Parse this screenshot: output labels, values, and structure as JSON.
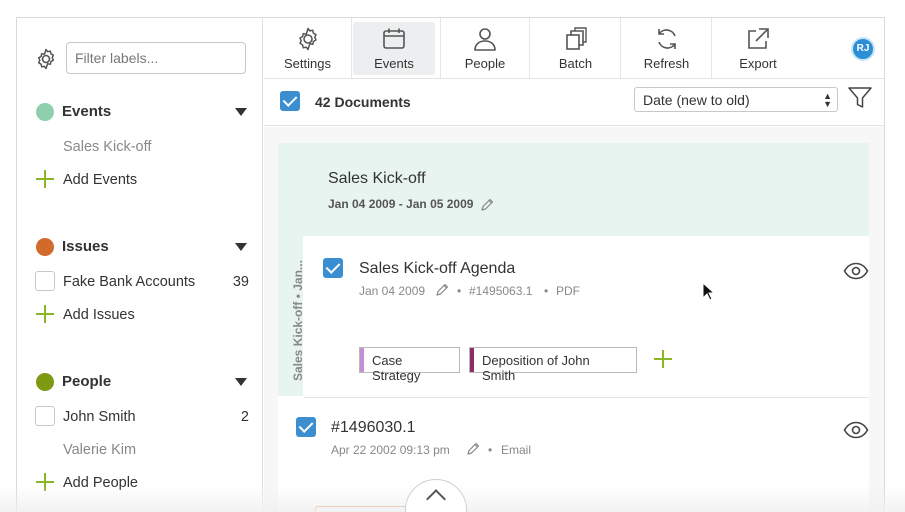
{
  "sidebar": {
    "filter_placeholder": "Filter labels...",
    "groups": [
      {
        "title": "Events",
        "dot_color": "#8ecfad",
        "items": [
          {
            "label": "Sales Kick-off"
          }
        ],
        "add_label": "Add Events"
      },
      {
        "title": "Issues",
        "dot_color": "#d26a2c",
        "items": [
          {
            "label": "Fake Bank Accounts",
            "count": "39"
          }
        ],
        "add_label": "Add Issues"
      },
      {
        "title": "People",
        "dot_color": "#7d9a10",
        "items": [
          {
            "label": "John Smith",
            "count": "2"
          },
          {
            "label": "Valerie Kim"
          }
        ],
        "add_label": "Add People"
      }
    ]
  },
  "toolbar": {
    "buttons": [
      {
        "label": "Settings",
        "icon": "gear-icon"
      },
      {
        "label": "Events",
        "icon": "calendar-icon",
        "active": true
      },
      {
        "label": "People",
        "icon": "person-icon"
      },
      {
        "label": "Batch",
        "icon": "batch-icon"
      },
      {
        "label": "Refresh",
        "icon": "refresh-icon"
      },
      {
        "label": "Export",
        "icon": "export-icon"
      }
    ],
    "avatar_initials": "RJ"
  },
  "docbar": {
    "count_label": "42 Documents",
    "sort_value": "Date (new to old)"
  },
  "event": {
    "title": "Sales Kick-off",
    "dates": "Jan 04 2009 - Jan 05 2009",
    "vertical_label": "Sales Kick-off • Jan..."
  },
  "documents": [
    {
      "title": "Sales Kick-off Agenda",
      "date": "Jan 04 2009",
      "id": "#1495063.1",
      "type": "PDF",
      "tags": [
        {
          "label": "Case Strategy",
          "color": "#c58ed3"
        },
        {
          "label": "Deposition of John Smith",
          "color": "#8c2c6a"
        }
      ]
    },
    {
      "title": "#1496030.1",
      "date": "Apr 22 2002 09:13 pm",
      "type": "Email"
    }
  ],
  "meta_separator": "•",
  "colors": {
    "accent_blue": "#3b8fd0",
    "add_green": "#8cb524",
    "event_bg": "#e8f4f0"
  }
}
